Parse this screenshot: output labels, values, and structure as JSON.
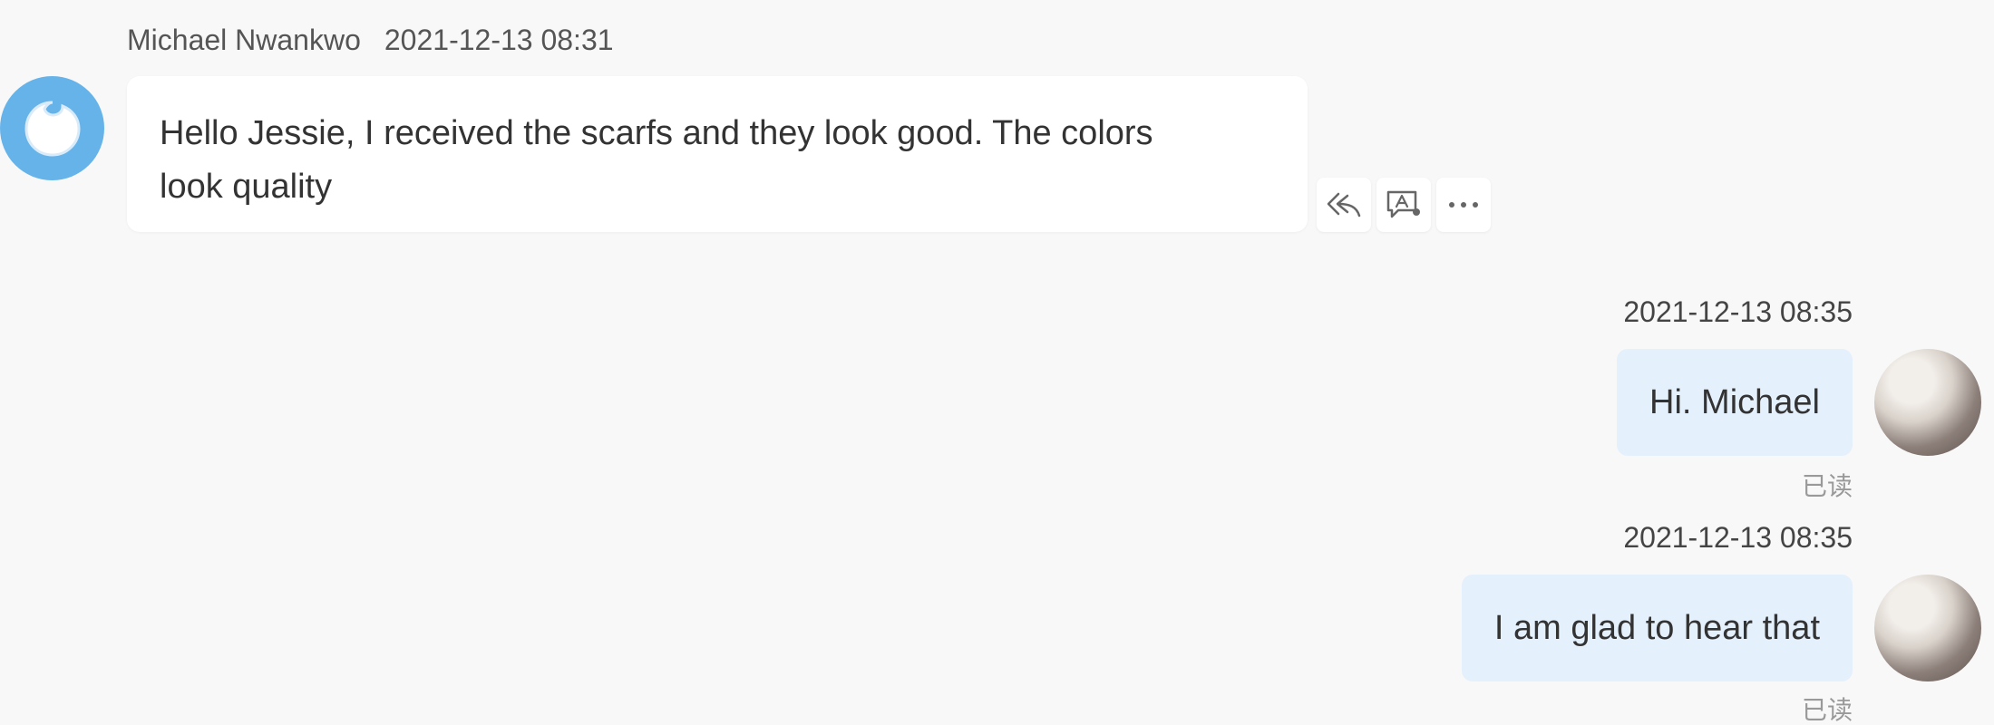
{
  "incoming": {
    "sender": "Michael Nwankwo",
    "time": "2021-12-13 08:31",
    "text_line1": "Hello Jessie, I received the scarfs and they look good. The colors",
    "text_line2": "look quality",
    "avatar_icon": "chat-bubble-avatar-icon",
    "avatar_color": "#66b3ea",
    "actions": [
      "reply-icon",
      "translate-icon",
      "more-icon"
    ]
  },
  "outgoing": [
    {
      "time": "2021-12-13 08:35",
      "text": "Hi. Michael",
      "status": "已读"
    },
    {
      "time": "2021-12-13 08:35",
      "text": "I am glad to hear that",
      "status": "已读"
    }
  ],
  "colors": {
    "background": "#f8f8f8",
    "incoming_bubble": "#ffffff",
    "outgoing_bubble": "#e5f0fd",
    "read_status": "#999999"
  }
}
